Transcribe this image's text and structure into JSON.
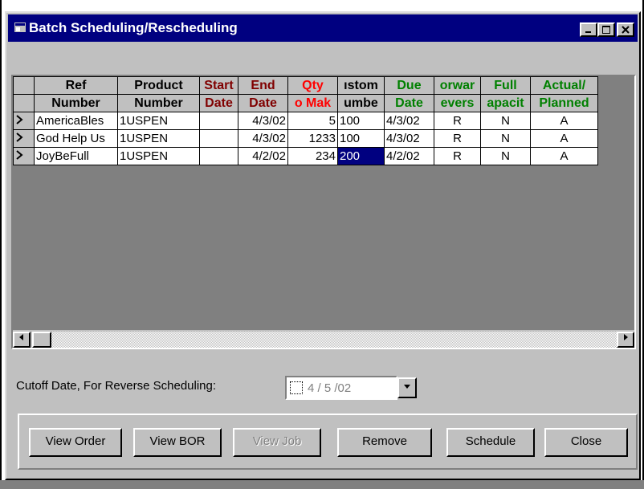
{
  "window": {
    "title": "Batch Scheduling/Rescheduling"
  },
  "columns": [
    {
      "line1": "Ref",
      "line2": "Number",
      "color": "#000000"
    },
    {
      "line1": "Product",
      "line2": "Number",
      "color": "#000000"
    },
    {
      "line1": "Start",
      "line2": "Date",
      "color": "#800000"
    },
    {
      "line1": "End",
      "line2": "Date",
      "color": "#800000"
    },
    {
      "line1": "Qty",
      "line2": "o Mak",
      "color": "#ff0000"
    },
    {
      "line1": "ıstom",
      "line2": "umbe",
      "color": "#000000"
    },
    {
      "line1": "Due",
      "line2": "Date",
      "color": "#008000"
    },
    {
      "line1": "orwar",
      "line2": "evers",
      "color": "#008000"
    },
    {
      "line1": "Full",
      "line2": "apacit",
      "color": "#008000"
    },
    {
      "line1": "Actual/",
      "line2": "Planned",
      "color": "#008000"
    }
  ],
  "rows": [
    {
      "ref": "AmericaBles",
      "product": "1USPEN",
      "start": "",
      "end": "4/3/02",
      "qty": "5",
      "customer": "100",
      "due": "4/3/02",
      "forward": "R",
      "full": "N",
      "actual": "A"
    },
    {
      "ref": "God Help Us",
      "product": "1USPEN",
      "start": "",
      "end": "4/3/02",
      "qty": "1233",
      "customer": "100",
      "due": "4/3/02",
      "forward": "R",
      "full": "N",
      "actual": "A"
    },
    {
      "ref": "JoyBeFull",
      "product": "1USPEN",
      "start": "",
      "end": "4/2/02",
      "qty": "234",
      "customer": "200",
      "due": "4/2/02",
      "forward": "R",
      "full": "N",
      "actual": "A"
    }
  ],
  "cutoff": {
    "label": "Cutoff Date, For Reverse Scheduling:",
    "value": "4 / 5 /02"
  },
  "buttons": {
    "view_order": "View Order",
    "view_bor": "View BOR",
    "view_job": "View Job",
    "remove": "Remove",
    "schedule": "Schedule",
    "close": "Close"
  },
  "icons": {
    "row_indicator": "triangle-right",
    "minimize": "minimize",
    "maximize": "maximize",
    "close": "close"
  }
}
